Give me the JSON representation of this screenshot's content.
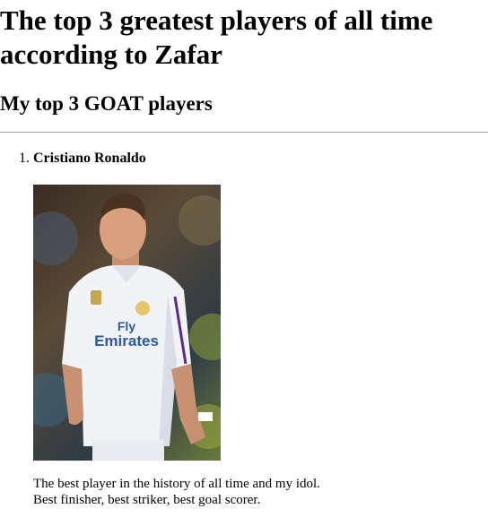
{
  "header": {
    "title": "The top 3 greatest players of all time according to Zafar",
    "subtitle": "My top 3 GOAT players"
  },
  "players": [
    {
      "rank": "1.",
      "name": "Cristiano Ronaldo",
      "description_line1": "The best player in the history of all time and my idol.",
      "description_line2": "Best finisher, best striker, best goal scorer.",
      "photo_text": "Fly Emirates"
    }
  ]
}
